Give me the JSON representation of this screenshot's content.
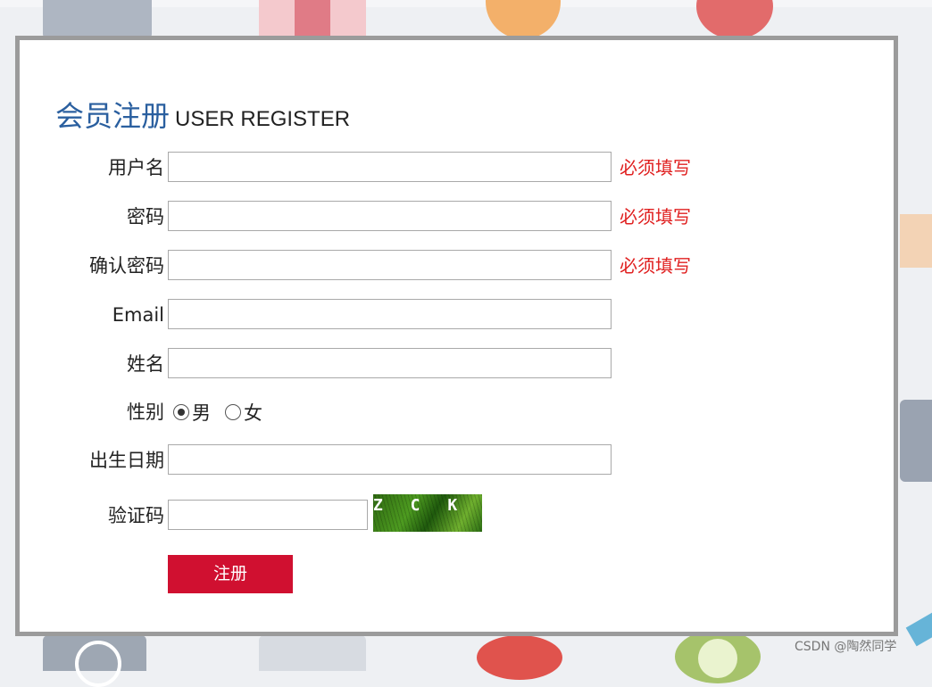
{
  "heading": {
    "title_cn": "会员注册",
    "title_en": "USER REGISTER"
  },
  "form": {
    "fields": [
      {
        "label": "用户名",
        "value": "",
        "required_note": "必须填写"
      },
      {
        "label": "密码",
        "value": "",
        "required_note": "必须填写"
      },
      {
        "label": "确认密码",
        "value": "",
        "required_note": "必须填写"
      },
      {
        "label": "Email",
        "value": ""
      },
      {
        "label": "姓名",
        "value": ""
      }
    ],
    "gender": {
      "label": "性别",
      "options": [
        "男",
        "女"
      ],
      "selected": "男"
    },
    "birthday": {
      "label": "出生日期",
      "value": ""
    },
    "captcha": {
      "label": "验证码",
      "value": "",
      "image_text": "Z C K X"
    },
    "submit_label": "注册"
  },
  "watermark": "CSDN @陶然同学",
  "colors": {
    "heading_blue": "#2a5f9f",
    "required_red": "#e02020",
    "button_red": "#d01030",
    "panel_border": "#9b9b9b"
  }
}
